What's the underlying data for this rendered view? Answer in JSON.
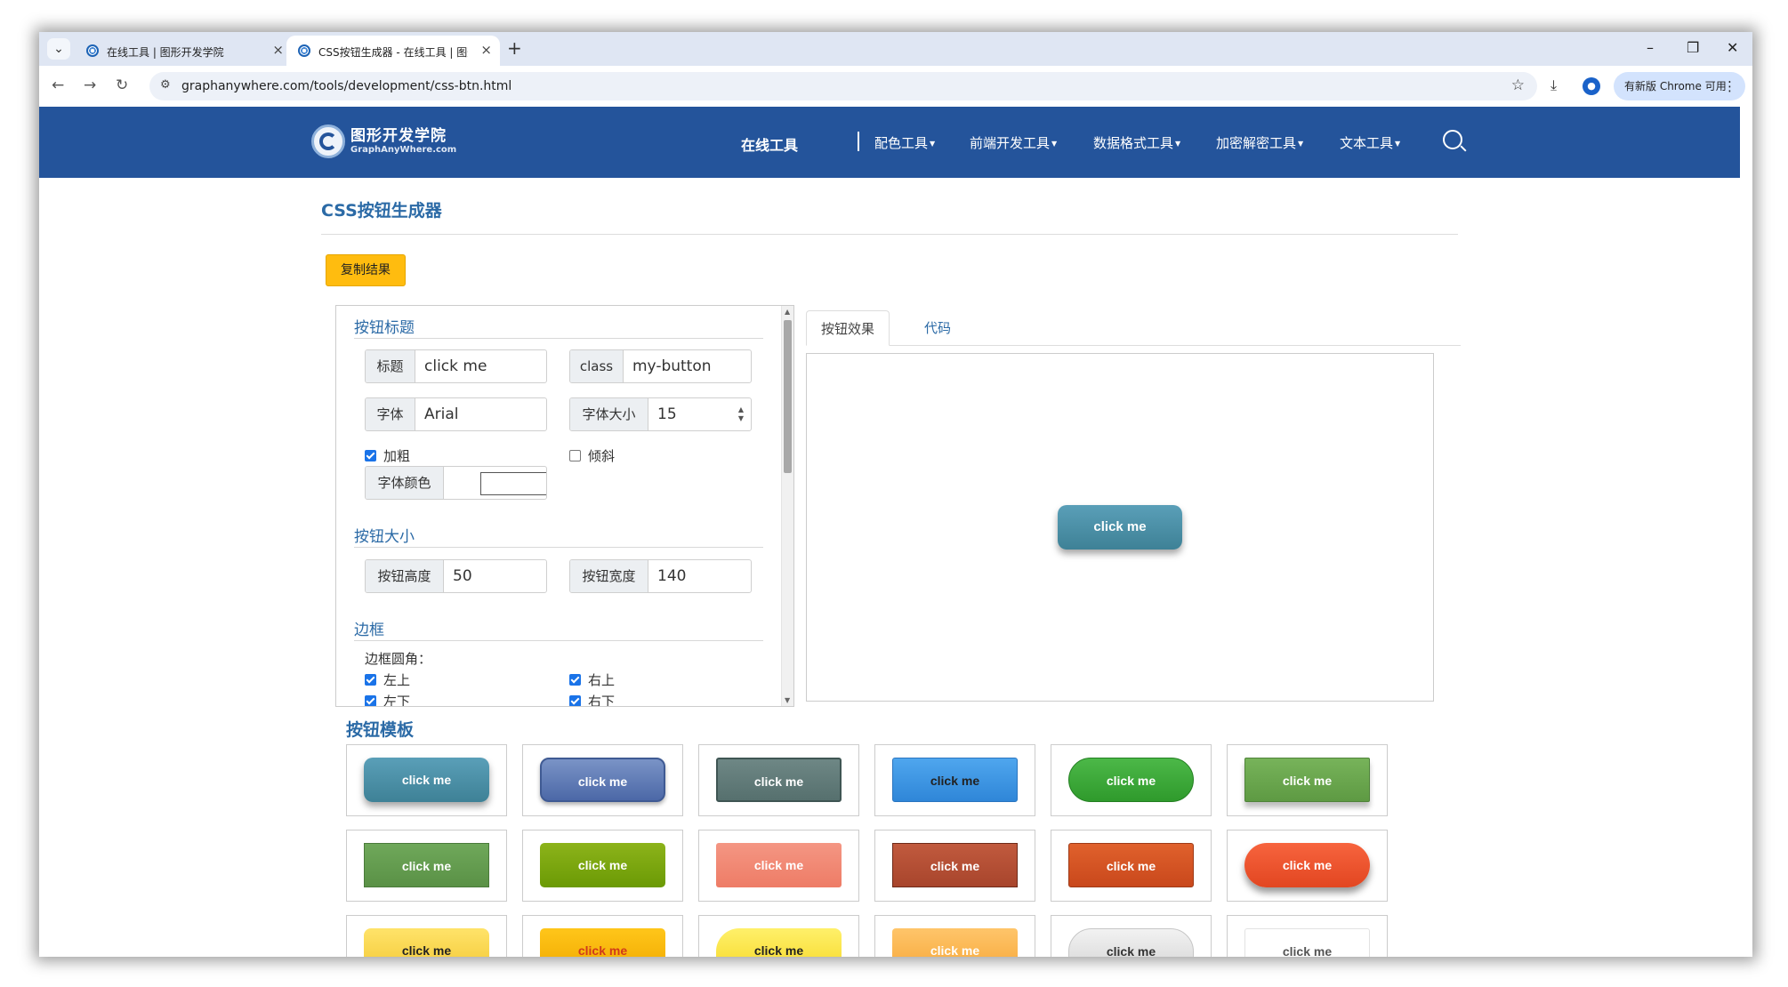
{
  "browser": {
    "tabs": [
      {
        "title": "在线工具 | 图形开发学院",
        "close": "×"
      },
      {
        "title": "CSS按钮生成器 - 在线工具 | 图形开发学院",
        "close": "×"
      }
    ],
    "new_tab": "+",
    "window": {
      "minimize": "–",
      "restore": "❐",
      "close": "✕"
    },
    "tab_dropdown": "⌄",
    "url": "graphanywhere.com/tools/development/css-btn.html",
    "update_label": "有新版 Chrome 可用",
    "menu_icon": "⋮"
  },
  "site": {
    "logo_cn": "图形开发学院",
    "logo_en": "GraphAnyWhere.com",
    "nav_main": "在线工具",
    "nav": [
      "配色工具",
      "前端开发工具",
      "数据格式工具",
      "加密解密工具",
      "文本工具"
    ]
  },
  "page": {
    "title": "CSS按钮生成器",
    "copy_button": "复制结果"
  },
  "settings": {
    "section_title": "按钮标题",
    "title_label": "标题",
    "title_value": "click me",
    "class_label": "class",
    "class_value": "my-button",
    "font_label": "字体",
    "font_value": "Arial",
    "font_size_label": "字体大小",
    "font_size_value": "15",
    "bold_label": "加粗",
    "bold_checked": true,
    "italic_label": "倾斜",
    "italic_checked": false,
    "font_color_label": "字体颜色",
    "font_color": "#ffffff",
    "size_section": "按钮大小",
    "height_label": "按钮高度",
    "height_value": "50",
    "width_label": "按钮宽度",
    "width_value": "140",
    "border_section": "边框",
    "radius_label": "边框圆角：",
    "corners": [
      {
        "label": "左上",
        "checked": true
      },
      {
        "label": "右上",
        "checked": true
      },
      {
        "label": "左下",
        "checked": true
      },
      {
        "label": "右下",
        "checked": true
      }
    ]
  },
  "preview": {
    "tab_effect": "按钮效果",
    "tab_code": "代码",
    "button_text": "click me"
  },
  "templates": {
    "title": "按钮模板",
    "items": [
      {
        "text": "click me",
        "style": "teal",
        "text_color": "#ffffff"
      },
      {
        "text": "click me",
        "style": "steelblue",
        "text_color": "#ffffff"
      },
      {
        "text": "click me",
        "style": "slate",
        "text_color": "#ffffff"
      },
      {
        "text": "click me",
        "style": "skyblue",
        "text_color": "#222222"
      },
      {
        "text": "click me",
        "style": "green",
        "text_color": "#ffffff"
      },
      {
        "text": "click me",
        "style": "leaf",
        "text_color": "#ffffff"
      },
      {
        "text": "click me",
        "style": "moss",
        "text_color": "#ffffff"
      },
      {
        "text": "click me",
        "style": "lime",
        "text_color": "#ffffff"
      },
      {
        "text": "click me",
        "style": "salmon",
        "text_color": "#ffffff"
      },
      {
        "text": "click me",
        "style": "brick",
        "text_color": "#ffffff"
      },
      {
        "text": "click me",
        "style": "rust",
        "text_color": "#ffffff"
      },
      {
        "text": "click me",
        "style": "tomato",
        "text_color": "#ffffff"
      },
      {
        "text": "click me",
        "style": "lemon",
        "text_color": "#222222"
      },
      {
        "text": "click me",
        "style": "amber",
        "text_color": "#d03a1a"
      },
      {
        "text": "click me",
        "style": "sun",
        "text_color": "#222222"
      },
      {
        "text": "click me",
        "style": "peach",
        "text_color": "#ffffff"
      },
      {
        "text": "click me",
        "style": "silver",
        "text_color": "#333333"
      },
      {
        "text": "click me",
        "style": "white",
        "text_color": "#555555"
      }
    ]
  },
  "colors": {
    "header_bg": "#24549b",
    "accent": "#2b6aa6",
    "copy_button": "#ffbc0f"
  }
}
